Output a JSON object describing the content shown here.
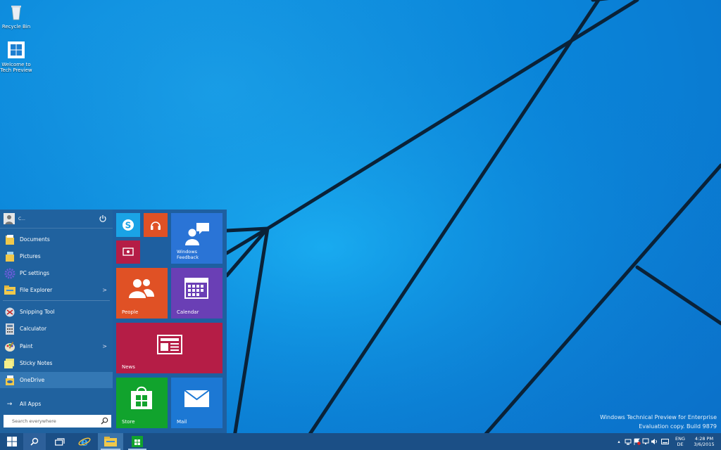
{
  "desktop": {
    "icons": [
      {
        "label": "Recycle Bin"
      },
      {
        "label": "Welcome to Tech Preview"
      }
    ],
    "watermark": {
      "line1": "Windows Technical Preview for Enterprise",
      "line2": "Evaluation copy. Build 9879"
    }
  },
  "start_menu": {
    "user_name": "C...",
    "items": [
      {
        "label": "Documents"
      },
      {
        "label": "Pictures"
      },
      {
        "label": "PC settings"
      },
      {
        "label": "File Explorer",
        "chevron": ">"
      },
      {
        "label": "Snipping Tool"
      },
      {
        "label": "Calculator"
      },
      {
        "label": "Paint",
        "chevron": ">"
      },
      {
        "label": "Sticky Notes"
      },
      {
        "label": "OneDrive"
      }
    ],
    "all_apps": {
      "label": "All Apps",
      "arrow": "→"
    },
    "search_placeholder": "Search everywhere",
    "tiles": [
      {
        "label": "Windows Feedback",
        "color": "#2a74d6"
      },
      {
        "label": "People",
        "color": "#e05125"
      },
      {
        "label": "Calendar",
        "color": "#6a3fb5"
      },
      {
        "label": "News",
        "color": "#b51d46"
      },
      {
        "label": "Store",
        "color": "#11a32d"
      },
      {
        "label": "Mail",
        "color": "#1c78d4"
      }
    ],
    "small_tiles": [
      {
        "name": "Skype",
        "color": "#1aa3e6"
      },
      {
        "name": "Music",
        "color": "#e05125"
      },
      {
        "name": "Video",
        "color": "#b51d46"
      }
    ]
  },
  "taskbar": {
    "lang_line1": "ENG",
    "lang_line2": "DE",
    "time": "4:28 PM",
    "date": "3/6/2015",
    "tray_arrow": "▴"
  },
  "colors": {
    "accent": "#1e5fa0",
    "taskbar": "#1b4f86"
  }
}
